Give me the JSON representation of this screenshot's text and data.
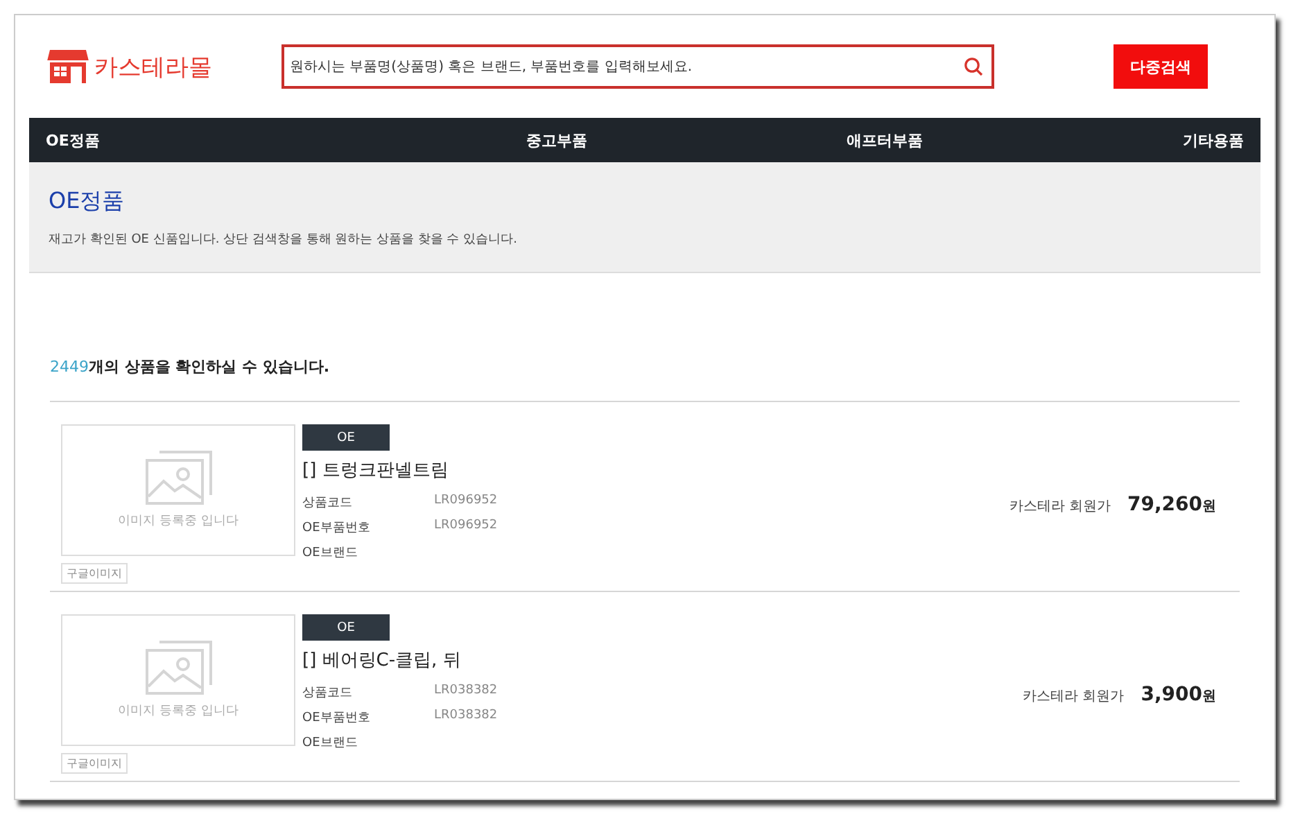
{
  "header": {
    "logo": "카스테라몰",
    "search": {
      "placeholder": "원하시는 부품명(상품명) 혹은 브랜드, 부품번호를 입력해보세요."
    },
    "multi_search_button": "다중검색"
  },
  "nav": [
    {
      "label": "OE정품"
    },
    {
      "label": "중고부품"
    },
    {
      "label": "애프터부품"
    },
    {
      "label": "기타용품"
    }
  ],
  "category": {
    "title": "OE정품",
    "description": "재고가 확인된 OE 신품입니다. 상단 검색창을 통해 원하는 상품을 찾을 수 있습니다."
  },
  "result": {
    "count": "2449",
    "suffix": "개의 상품을 확인하실 수 있습니다."
  },
  "products": [
    {
      "badge": "OE",
      "title": "[] 트렁크판넬트림",
      "image_text": "이미지 등록중 입니다",
      "image_button": "구글이미지",
      "specs": [
        {
          "label": "상품코드",
          "value": "LR096952"
        },
        {
          "label": "OE부품번호",
          "value": "LR096952"
        },
        {
          "label": "OE브랜드"
        }
      ],
      "price_label": "카스테라 회원가",
      "price": "79,260",
      "price_unit": "원"
    },
    {
      "badge": "OE",
      "title": "[] 베어링C-클립, 뒤",
      "image_text": "이미지 등록중 입니다",
      "image_button": "구글이미지",
      "specs": [
        {
          "label": "상품코드",
          "value": "LR038382"
        },
        {
          "label": "OE부품번호",
          "value": "LR038382"
        },
        {
          "label": "OE브랜드"
        }
      ],
      "price_label": "카스테라 회원가",
      "price": "3,900",
      "price_unit": "원"
    }
  ]
}
